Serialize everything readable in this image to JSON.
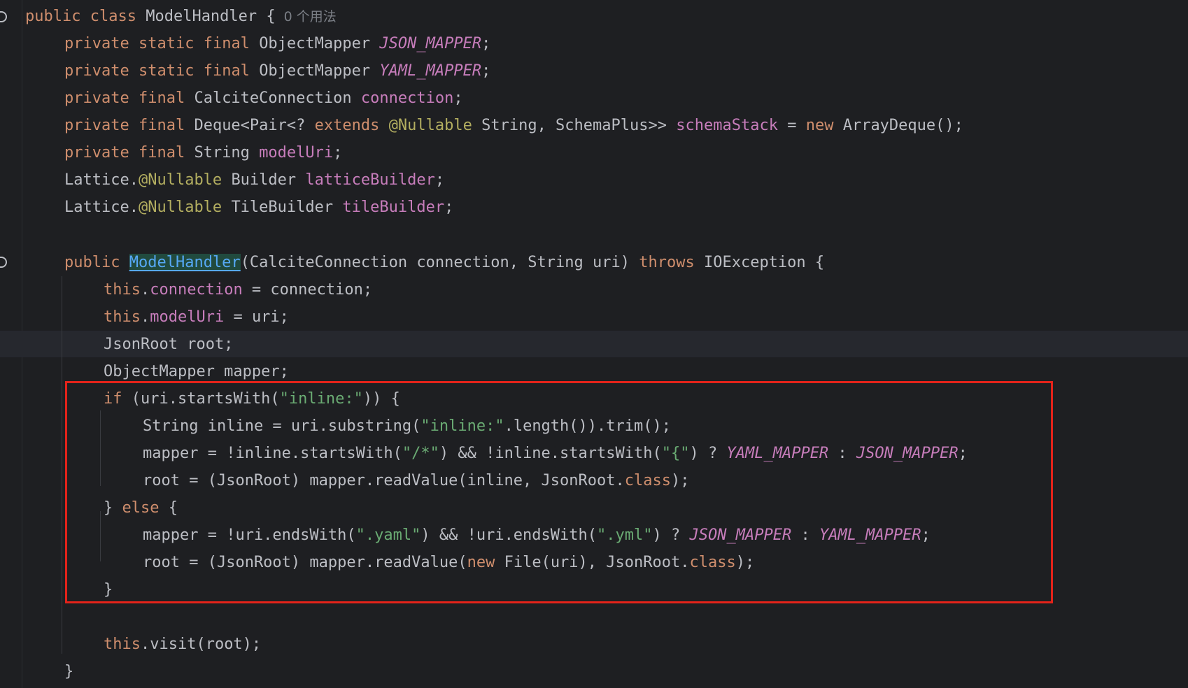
{
  "usage_hint": "0 个用法",
  "code": {
    "class_decl": {
      "kw1": "public",
      "kw2": "class",
      "name": "ModelHandler",
      "brace": "{"
    },
    "f1": {
      "kw1": "private",
      "kw2": "static",
      "kw3": "final",
      "type": "ObjectMapper",
      "name": "JSON_MAPPER",
      "end": ";"
    },
    "f2": {
      "kw1": "private",
      "kw2": "static",
      "kw3": "final",
      "type": "ObjectMapper",
      "name": "YAML_MAPPER",
      "end": ";"
    },
    "f3": {
      "kw1": "private",
      "kw2": "final",
      "type": "CalciteConnection",
      "name": "connection",
      "end": ";"
    },
    "f4": {
      "kw1": "private",
      "kw2": "final",
      "t1": "Deque<Pair<?",
      "ext": "extends",
      "ann": "@Nullable",
      "t2": "String, SchemaPlus>>",
      "name": "schemaStack",
      "eq": "=",
      "new": "new",
      "t3": "ArrayDeque();"
    },
    "f5": {
      "kw1": "private",
      "kw2": "final",
      "type": "String",
      "name": "modelUri",
      "end": ";"
    },
    "f6": {
      "pre": "Lattice.",
      "ann": "@Nullable",
      "type": "Builder",
      "name": "latticeBuilder",
      "end": ";"
    },
    "f7": {
      "pre": "Lattice.",
      "ann": "@Nullable",
      "type": "TileBuilder",
      "name": "tileBuilder",
      "end": ";"
    },
    "ctor": {
      "kw": "public",
      "name": "ModelHandler",
      "params": "(CalciteConnection connection, String uri)",
      "throws": "throws",
      "exc": "IOException {"
    },
    "s1": {
      "this": "this",
      "dot": ".",
      "field": "connection",
      "rest": " = connection;"
    },
    "s2": {
      "this": "this",
      "dot": ".",
      "field": "modelUri",
      "rest": " = uri;"
    },
    "s3": {
      "text": "JsonRoot root;"
    },
    "s4": {
      "text": "ObjectMapper mapper;"
    },
    "s5": {
      "kw": "if",
      "a": " (uri.startsWith(",
      "str": "\"inline:\"",
      "b": ")) {"
    },
    "s6": {
      "a": "String inline = uri.substring(",
      "str": "\"inline:\"",
      "b": ".length()).trim();"
    },
    "s7": {
      "a": "mapper = !inline.startsWith(",
      "str1": "\"/*\"",
      "b": ") && !inline.startsWith(",
      "str2": "\"{\"",
      "c": ") ? ",
      "m1": "YAML_MAPPER",
      "d": " : ",
      "m2": "JSON_MAPPER",
      "e": ";"
    },
    "s8": {
      "a": "root = (JsonRoot) mapper.readValue(inline, JsonRoot.",
      "kw": "class",
      "b": ");"
    },
    "s9": {
      "a": "} ",
      "kw": "else",
      "b": " {"
    },
    "s10": {
      "a": "mapper = !uri.endsWith(",
      "str1": "\".yaml\"",
      "b": ") && !uri.endsWith(",
      "str2": "\".yml\"",
      "c": ") ? ",
      "m1": "JSON_MAPPER",
      "d": " : ",
      "m2": "YAML_MAPPER",
      "e": ";"
    },
    "s11": {
      "a": "root = (JsonRoot) mapper.readValue(",
      "new": "new",
      "b": " File(uri), JsonRoot.",
      "kw": "class",
      "c": ");"
    },
    "s12": {
      "text": "}"
    },
    "s13": {
      "this": "this",
      "rest": ".visit(root);"
    },
    "s14": {
      "text": "}"
    }
  },
  "colors": {
    "background": "#1e1f22",
    "keyword": "#cf8e6d",
    "field": "#c77dbb",
    "string": "#6aab73",
    "annotation": "#b3ae60",
    "plain": "#bcbec4",
    "highlight_box": "#e3231a"
  }
}
